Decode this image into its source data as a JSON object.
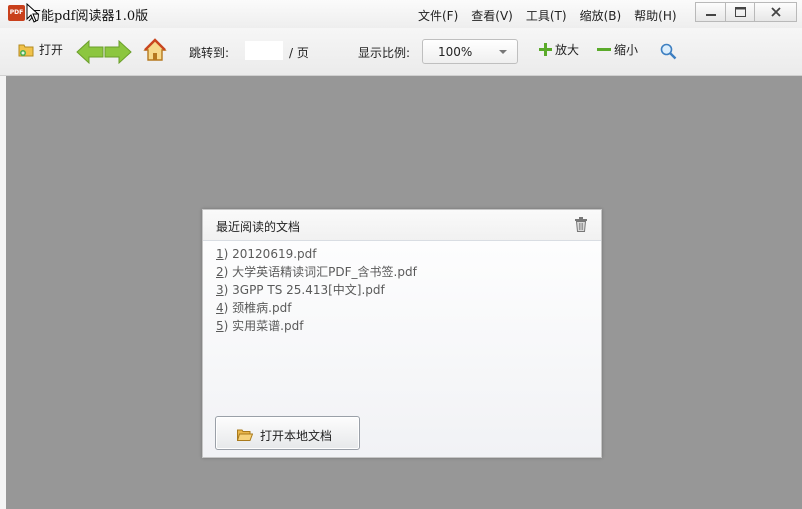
{
  "titlebar": {
    "app_icon_text": "PDF",
    "title": "万能pdf阅读器1.0版",
    "menu": [
      "文件(F)",
      "查看(V)",
      "工具(T)",
      "缩放(B)",
      "帮助(H)"
    ]
  },
  "toolbar": {
    "open_label": "打开",
    "jump_label": "跳转到:",
    "page_value": "",
    "page_suffix": "/ 页",
    "zoom_label": "显示比例:",
    "zoom_value": "100%",
    "zoom_in_label": "放大",
    "zoom_out_label": "缩小"
  },
  "recent_panel": {
    "title": "最近阅读的文档",
    "items": [
      {
        "num": "1",
        "name": "20120619.pdf"
      },
      {
        "num": "2",
        "name": "大学英语精读词汇PDF_含书签.pdf"
      },
      {
        "num": "3",
        "name": "3GPP TS 25.413[中文].pdf"
      },
      {
        "num": "4",
        "name": "颈椎病.pdf"
      },
      {
        "num": "5",
        "name": "实用菜谱.pdf"
      }
    ],
    "open_local_label": "打开本地文档"
  },
  "colors": {
    "viewer_bg": "#979797",
    "arrow_green": "#8cc63f",
    "accent_green": "#5aaa2a"
  }
}
